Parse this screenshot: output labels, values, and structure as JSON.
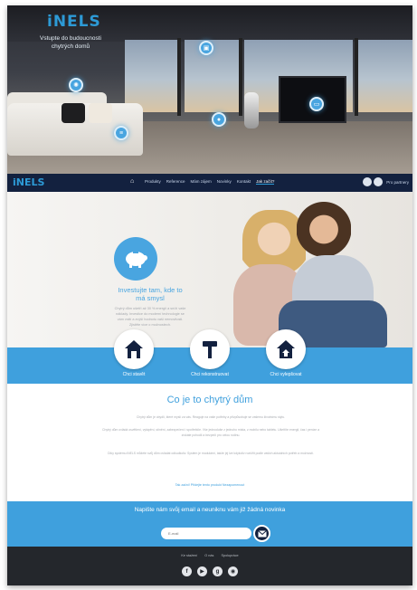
{
  "hero": {
    "logo": "iNELS",
    "tagline": "Vstupte do budoucnosti chytrých domů"
  },
  "nav": {
    "logo": "iNELS",
    "links": [
      "Produkty",
      "Reference",
      "Mám zájem",
      "Novinky",
      "Kontakt",
      "Jak začít?"
    ],
    "user": "Pro partnery"
  },
  "invest": {
    "title": "Investujte tam, kde to má smysl",
    "text": "Chytrý dům ušetří až 30 % energií a sníží vaše náklady. Investice do moderní technologie se vám vrátí a zvýší hodnotu vaší nemovitosti. Zjistěte více o možnostech."
  },
  "features": [
    {
      "label": "Chci stavět",
      "icon": "house-icon"
    },
    {
      "label": "Chci rekonstruovat",
      "icon": "hammer-icon"
    },
    {
      "label": "Chci vylepšovat",
      "icon": "house-plus-icon"
    }
  ],
  "info": {
    "title": "Co je to chytrý dům",
    "p1": "Chytrý dům je obydlí, které myslí za vás. Reaguje na vaše potřeby a přizpůsobuje se vašemu životnímu stylu.",
    "p2": "Chytrý dům ovládá osvětlení, vytápění, stínění, zabezpečení i spotřebiče. Vše jednoduše z jednoho místa, z mobilu nebo tabletu. Ušetříte energii, čas i peníze a získáte pohodlí a bezpečí pro celou rodinu.",
    "p3": "Díky systému iNELS můžete svůj dům ovládat odkudkoliv. Systém je modulární, takže jej lze kdykoliv rozšířit podle vašich aktuálních potřeb a možností.",
    "link": "Tak začni! Přidejte tento produkt Nezapomenout"
  },
  "newsletter": {
    "title": "Napište nám svůj email a neuniknu vám již žádná novinka",
    "placeholder": "E-mail"
  },
  "footer": {
    "links": [
      "Ke stažení",
      "O nás",
      "Spolupráce"
    ],
    "social": [
      {
        "icon": "facebook-icon",
        "glyph": "f"
      },
      {
        "icon": "youtube-icon",
        "glyph": "▶"
      },
      {
        "icon": "googleplus-icon",
        "glyph": "g"
      },
      {
        "icon": "instagram-icon",
        "glyph": "◉"
      }
    ]
  },
  "colors": {
    "accent": "#3fa0dd",
    "navy": "#13213f",
    "footer": "#24272c"
  }
}
